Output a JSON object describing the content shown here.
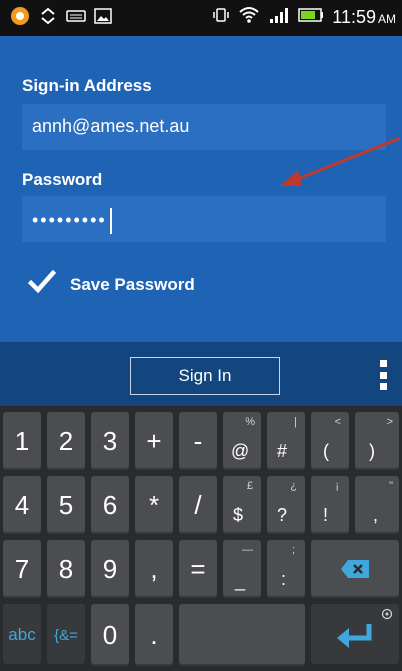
{
  "status_bar": {
    "time": "11:59",
    "ampm": "AM"
  },
  "form": {
    "signin_label": "Sign-in Address",
    "signin_value": "annh@ames.net.au",
    "password_label": "Password",
    "password_value": "•••••••••",
    "save_password_label": "Save Password",
    "save_password_checked": true
  },
  "action_bar": {
    "signin_button": "Sign In"
  },
  "keyboard": {
    "row1": [
      {
        "main": "1"
      },
      {
        "main": "2"
      },
      {
        "main": "3"
      },
      {
        "main": "+"
      },
      {
        "main": "-"
      },
      {
        "main": "@",
        "top": "%"
      },
      {
        "main": "#",
        "top": "|"
      },
      {
        "main": "(",
        "top": "<"
      },
      {
        "main": ")",
        "top": ">"
      }
    ],
    "row2": [
      {
        "main": "4"
      },
      {
        "main": "5"
      },
      {
        "main": "6"
      },
      {
        "main": "*"
      },
      {
        "main": "/"
      },
      {
        "main": "$",
        "top": "£"
      },
      {
        "main": "?",
        "top": "¿"
      },
      {
        "main": "!",
        "top": "¡"
      },
      {
        "main": ",",
        "top": "\""
      }
    ],
    "row3": [
      {
        "main": "7"
      },
      {
        "main": "8"
      },
      {
        "main": "9"
      },
      {
        "main": ","
      },
      {
        "main": "="
      },
      {
        "main": "_",
        "top": "—"
      },
      {
        "main": ":",
        "top": ";"
      }
    ],
    "abc_label": "abc",
    "symbols_label": "{&=",
    "zero": "0",
    "period": "."
  },
  "colors": {
    "panel": "#1f63b5",
    "action_bar": "#13467f",
    "keyboard_accent": "#40a7dd",
    "annotation_arrow": "#c0392b"
  }
}
